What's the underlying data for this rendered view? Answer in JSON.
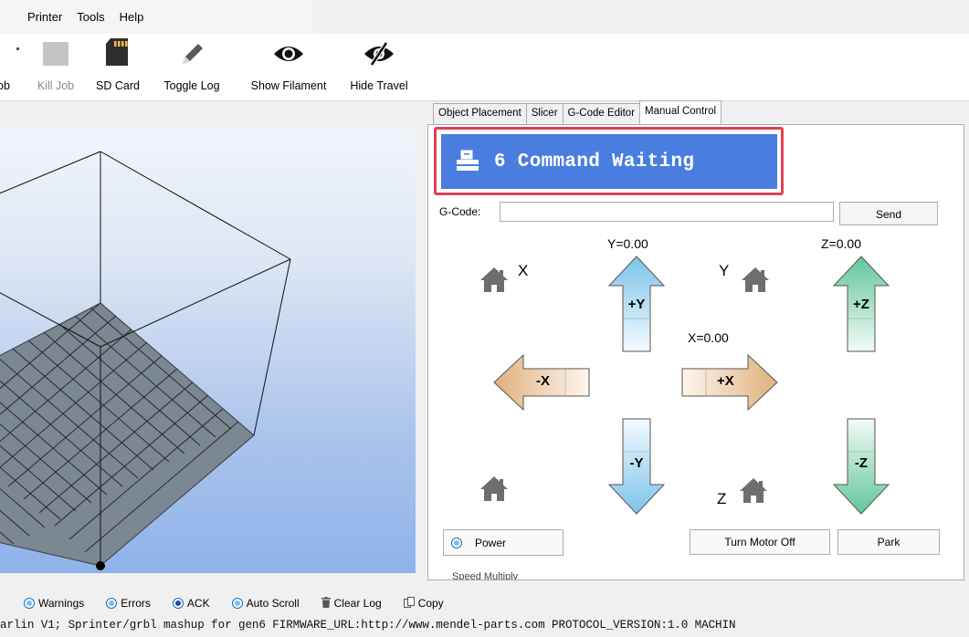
{
  "menu": [
    "Printer",
    "Tools",
    "Help"
  ],
  "toolbar": {
    "buttons": [
      {
        "label": "ob",
        "icon": "run-job-icon"
      },
      {
        "label": "Kill Job",
        "icon": "kill-job-icon"
      },
      {
        "label": "SD Card",
        "icon": "sd-card-icon"
      },
      {
        "label": "Toggle Log",
        "icon": "pencil-icon"
      },
      {
        "label": "Show Filament",
        "icon": "eye-icon"
      },
      {
        "label": "Hide Travel",
        "icon": "eye-slash-icon"
      }
    ]
  },
  "tabs": [
    {
      "label": "Object Placement",
      "active": false
    },
    {
      "label": "Slicer",
      "active": false
    },
    {
      "label": "G-Code Editor",
      "active": false
    },
    {
      "label": "Manual Control",
      "active": true
    }
  ],
  "manual_control": {
    "status": {
      "icon": "printer-icon",
      "text": "6 Command Waiting",
      "color": "#4a7de0",
      "highlight_color": "#e04155"
    },
    "gcode": {
      "label": "G-Code:",
      "value": "",
      "send_label": "Send"
    },
    "coords": {
      "y": "Y=0.00",
      "z": "Z=0.00",
      "x": "X=0.00"
    },
    "jog": {
      "plus_y": "+Y",
      "minus_y": "-Y",
      "plus_x": "+X",
      "minus_x": "-X",
      "plus_z": "+Z",
      "minus_z": "-Z"
    },
    "home_labels": {
      "x": "X",
      "y": "Y",
      "z": "Z"
    },
    "buttons": {
      "power": "Power",
      "motor_off": "Turn Motor Off",
      "park": "Park"
    },
    "cut_text": "Speed Multiply"
  },
  "log_toolbar": {
    "items": [
      {
        "label": "Warnings",
        "icon": "radio-icon"
      },
      {
        "label": "Errors",
        "icon": "radio-icon"
      },
      {
        "label": "ACK",
        "icon": "radio-icon"
      },
      {
        "label": "Auto Scroll",
        "icon": "radio-icon"
      },
      {
        "label": "Clear Log",
        "icon": "trash-icon"
      },
      {
        "label": "Copy",
        "icon": "copy-icon"
      }
    ]
  },
  "log_line": "arlin V1; Sprinter/grbl mashup for gen6 FIRMWARE_URL:http://www.mendel-parts.com PROTOCOL_VERSION:1.0 MACHIN"
}
